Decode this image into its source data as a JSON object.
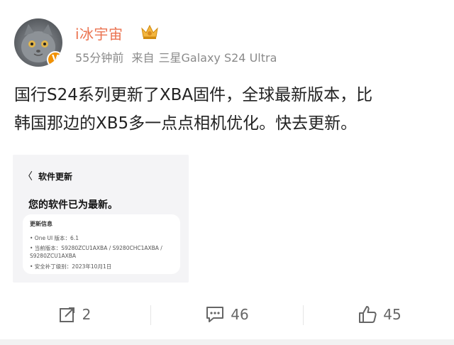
{
  "post": {
    "username": "i冰宇宙",
    "time": "55分钟前",
    "source_prefix": "来自",
    "source_device": "三星Galaxy S24 Ultra",
    "verified_badge": "V",
    "text_line1": "国行S24系列更新了XBA固件，全球最新版本，比",
    "text_line2": "韩国那边的XB5多一点点相机优化。快去更新。"
  },
  "screenshot": {
    "back_glyph": "〈",
    "title": "软件更新",
    "status": "您的软件已为最新。",
    "card_title": "更新信息",
    "line1": "• One UI 版本：6.1",
    "line2": "• 当前版本：S9280ZCU1AXBA / S9280CHC1AXBA /",
    "line3": "  S9280ZCU1AXBA",
    "line4": "• 安全补丁级别：2023年10月1日"
  },
  "actions": {
    "repost_count": "2",
    "comment_count": "46",
    "like_count": "45"
  },
  "icons": {
    "repost": "repost-icon",
    "comment": "comment-icon",
    "like": "thumbs-up-icon",
    "crown": "crown-badge-icon"
  },
  "colors": {
    "username": "#eb7350",
    "meta": "#8a8a8a",
    "verified": "#f29100"
  }
}
